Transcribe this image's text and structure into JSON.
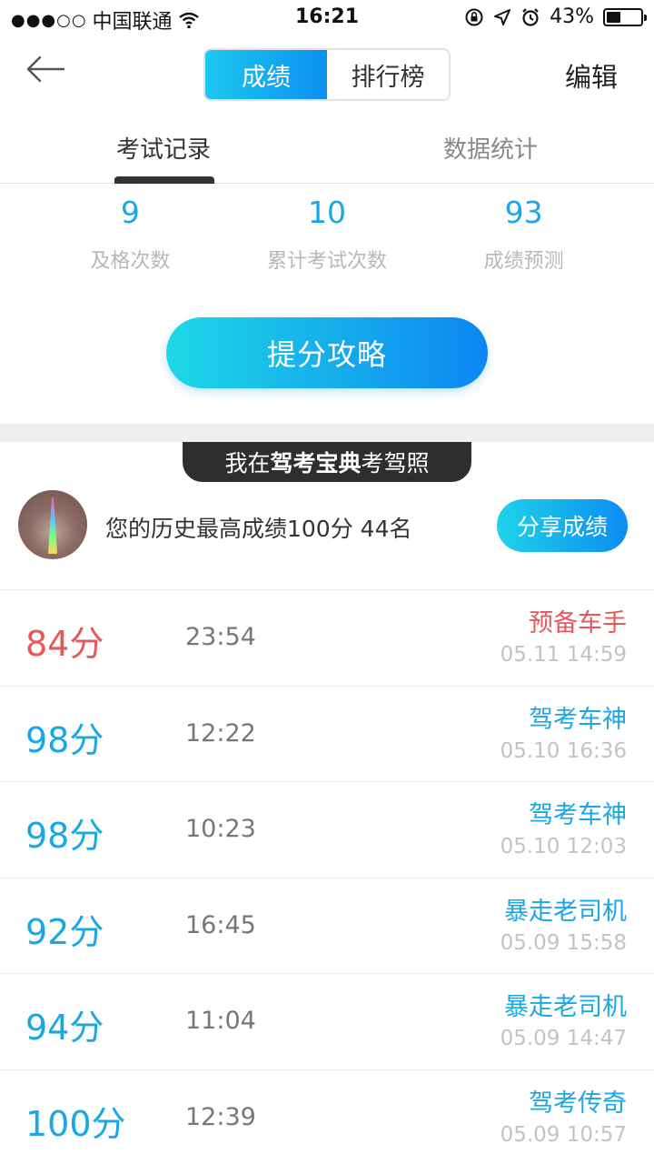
{
  "status_bar": {
    "carrier": "中国联通",
    "signal_dots": "●●●○○",
    "time": "16:21",
    "battery_percent": "43%",
    "battery_level": 0.43
  },
  "nav": {
    "tabs": [
      "成绩",
      "排行榜"
    ],
    "active_tab": 0,
    "edit_label": "编辑"
  },
  "sub_tabs": {
    "items": [
      "考试记录",
      "数据统计"
    ],
    "active": 0
  },
  "stats": [
    {
      "value": "9",
      "label": "及格次数"
    },
    {
      "value": "10",
      "label": "累计考试次数"
    },
    {
      "value": "93",
      "label": "成绩预测"
    }
  ],
  "strategy_button": "提分攻略",
  "banner": {
    "prefix": "我在",
    "bold": "驾考宝典",
    "suffix": "考驾照"
  },
  "best": {
    "text": "您的历史最高成绩100分  44名",
    "share_label": "分享成绩"
  },
  "records": [
    {
      "score": "84分",
      "duration": "23:54",
      "title": "预备车手",
      "date": "05.11 14:59",
      "pass": false
    },
    {
      "score": "98分",
      "duration": "12:22",
      "title": "驾考车神",
      "date": "05.10 16:36",
      "pass": true
    },
    {
      "score": "98分",
      "duration": "10:23",
      "title": "驾考车神",
      "date": "05.10 12:03",
      "pass": true
    },
    {
      "score": "92分",
      "duration": "16:45",
      "title": "暴走老司机",
      "date": "05.09 15:58",
      "pass": true
    },
    {
      "score": "94分",
      "duration": "11:04",
      "title": "暴走老司机",
      "date": "05.09 14:47",
      "pass": true
    },
    {
      "score": "100分",
      "duration": "12:39",
      "title": "驾考传奇",
      "date": "05.09 10:57",
      "pass": true
    }
  ]
}
